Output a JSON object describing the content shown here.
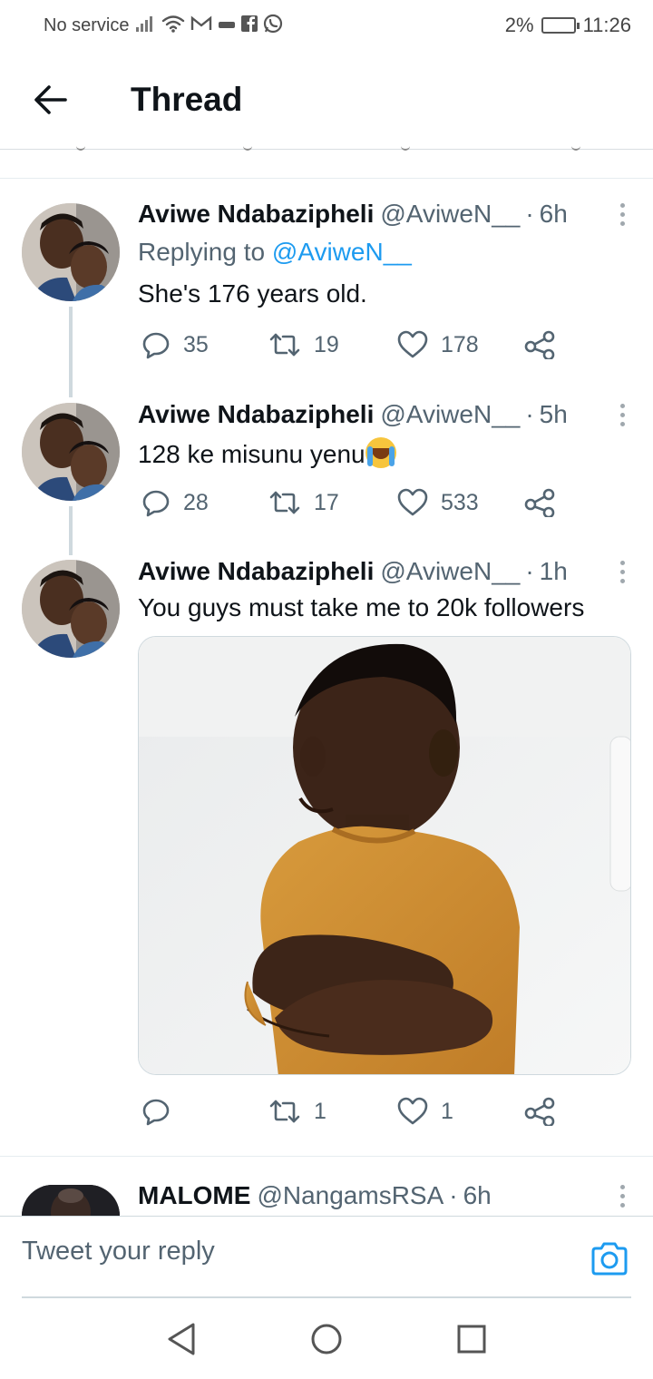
{
  "status_bar": {
    "carrier": "No service",
    "battery_percent": "2%",
    "time": "11:26"
  },
  "header": {
    "title": "Thread",
    "back_icon": "arrow-left-icon"
  },
  "tweets": [
    {
      "name": "Aviwe Ndabazipheli",
      "handle": "@AviweN__",
      "dot": "·",
      "time": "6h",
      "reply_prefix": "Replying to ",
      "reply_mention": "@AviweN__",
      "text": "She's 176 years old.",
      "replies": "35",
      "retweets": "19",
      "likes": "178"
    },
    {
      "name": "Aviwe Ndabazipheli",
      "handle": "@AviweN__",
      "dot": "·",
      "time": "5h",
      "text": "128 ke misunu yenu",
      "emoji": "loudly-crying-face-emoji",
      "replies": "28",
      "retweets": "17",
      "likes": "533"
    },
    {
      "name": "Aviwe Ndabazipheli",
      "handle": "@AviweN__",
      "dot": "·",
      "time": "1h",
      "text": "You guys must take me to 20k followers",
      "media": "photo of a boy in an orange shirt with crossed arms",
      "replies": "",
      "retweets": "1",
      "likes": "1"
    },
    {
      "name": "MALOME",
      "handle": "@NangamsRSA",
      "dot": "·",
      "time": "6h"
    }
  ],
  "composer": {
    "placeholder": "Tweet your reply",
    "camera_icon": "camera-icon"
  },
  "colors": {
    "accent": "#1d9bf0",
    "text": "#0f1419",
    "muted": "#536471",
    "border": "#cfd9de"
  }
}
